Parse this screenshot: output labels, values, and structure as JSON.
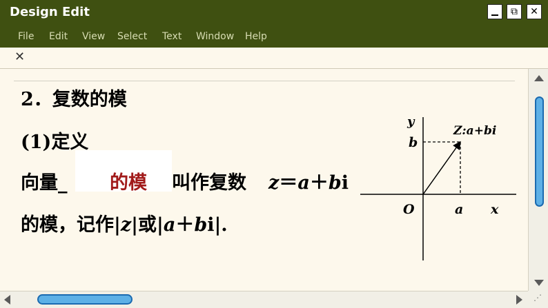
{
  "window": {
    "title": "Design Edit",
    "controls": {
      "minimize": "",
      "maximize": "⧉",
      "close": "✕"
    }
  },
  "menu": {
    "items": [
      "File",
      "Edit",
      "View",
      "Select",
      "Text",
      "Window",
      "Help"
    ]
  },
  "tab": {
    "close": "✕"
  },
  "document": {
    "heading": "2．复数的模",
    "subheading": "(1)定义",
    "line3_prefix": "向量_",
    "answer": "的模",
    "line3_suffix": "叫作复数",
    "formula_var": "z",
    "formula_eq": "＝",
    "formula_a": "a",
    "formula_plus": "＋",
    "formula_b": "b",
    "formula_i": "i",
    "line4_prefix": "的模，记作|",
    "line4_z": "z",
    "line4_mid": "|或|",
    "line4_a": "a",
    "line4_plus": "＋",
    "line4_b": "b",
    "line4_suffix": "i|."
  },
  "diagram": {
    "y_label": "y",
    "x_label": "x",
    "origin_label": "O",
    "b_label": "b",
    "a_label": "a",
    "point_label": "Z:a+bi"
  },
  "colors": {
    "titlebar": "#3f5011",
    "menu_text": "#d7dcb2",
    "background": "#fdf8ec",
    "answer_text": "#a11a1a",
    "scroll_thumb": "#5db0e6"
  },
  "icons": {
    "scroll_up": "triangle-up",
    "scroll_down": "triangle-down",
    "scroll_left": "triangle-left",
    "scroll_right": "triangle-right"
  }
}
